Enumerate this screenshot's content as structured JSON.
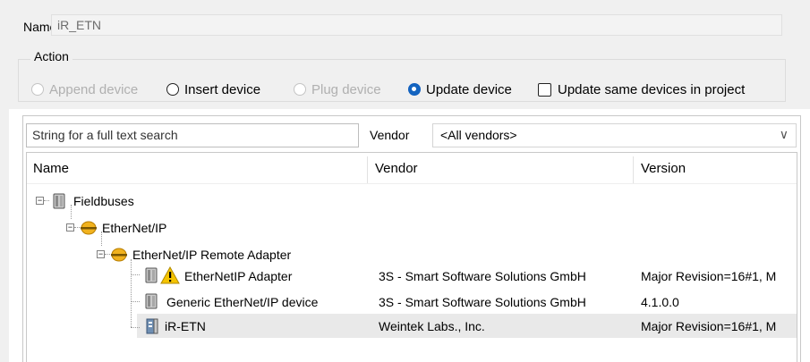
{
  "name_label": "Name",
  "name_value": "iR_ETN",
  "action": {
    "legend": "Action",
    "options": [
      {
        "label": "Append device",
        "state": "disabled"
      },
      {
        "label": "Insert device",
        "state": "enabled"
      },
      {
        "label": "Plug device",
        "state": "disabled"
      },
      {
        "label": "Update device",
        "state": "selected"
      }
    ],
    "checkbox_label": "Update same devices in project",
    "checkbox_checked": false
  },
  "search": {
    "placeholder": "String for a full text search"
  },
  "vendor_filter": {
    "label": "Vendor",
    "selected": "<All vendors>"
  },
  "columns": [
    "Name",
    "Vendor",
    "Version"
  ],
  "tree": [
    {
      "name": "Fieldbuses",
      "vendor": "",
      "version": "",
      "icon": "device-module-icon",
      "expanded": true
    },
    {
      "name": "EtherNet/IP",
      "vendor": "",
      "version": "",
      "icon": "bus-disc-icon",
      "expanded": true
    },
    {
      "name": "EtherNet/IP Remote Adapter",
      "vendor": "",
      "version": "",
      "icon": "bus-disc-icon",
      "expanded": true
    },
    {
      "name": "EtherNetIP Adapter",
      "vendor": "3S - Smart Software Solutions GmbH",
      "version": "Major Revision=16#1, M",
      "icon": "device-module-icon",
      "warning": true
    },
    {
      "name": "Generic EtherNet/IP device",
      "vendor": "3S - Smart Software Solutions GmbH",
      "version": "4.1.0.0",
      "icon": "device-module-icon"
    },
    {
      "name": "iR-ETN",
      "vendor": "Weintek Labs., Inc.",
      "version": "Major Revision=16#1, M",
      "icon": "io-module-icon",
      "selected": true
    }
  ],
  "colors": {
    "selected_radio": "#1565c0",
    "warning": "#f5c400",
    "bus_icon": "#e8a000"
  }
}
